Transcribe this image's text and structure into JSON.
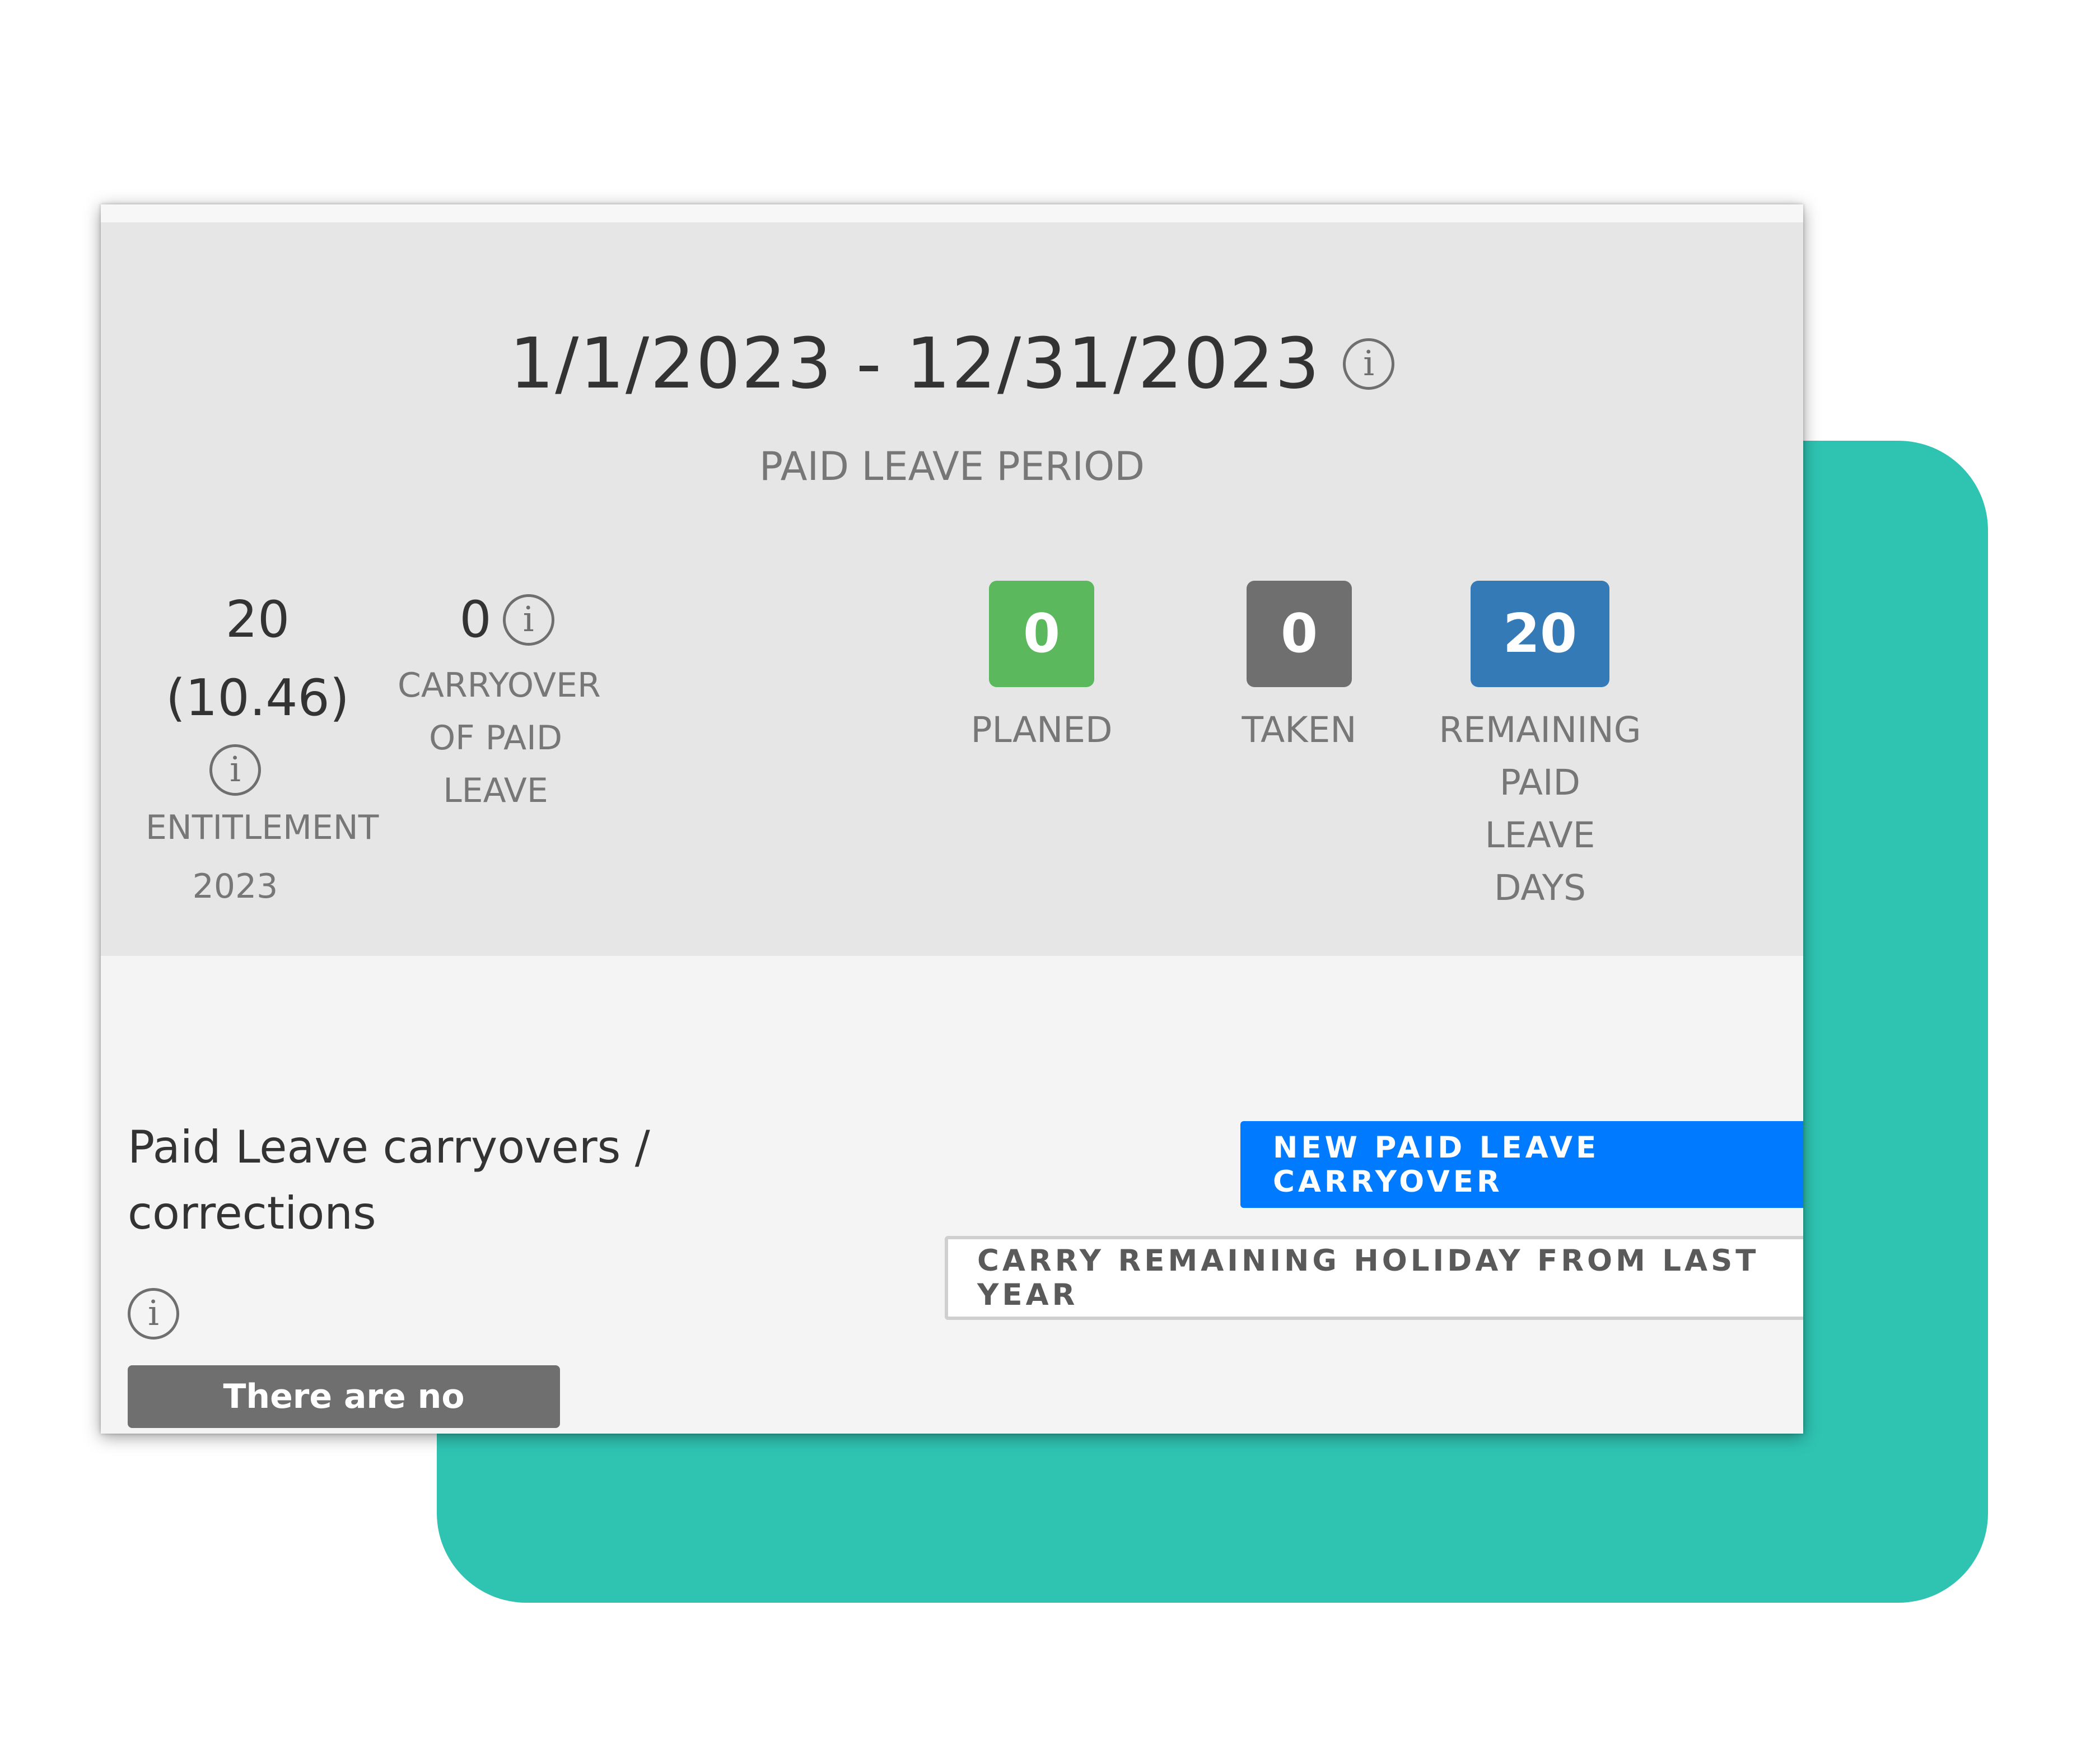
{
  "period": {
    "dates": "1/1/2023 - 12/31/2023",
    "label": "PAID LEAVE PERIOD",
    "info_icon": "info-icon"
  },
  "entitlement": {
    "value_line1": "20",
    "value_line2": "(10.46)",
    "label": "ENTITLEMENT",
    "year": "2023"
  },
  "carryover": {
    "value": "0",
    "label_line1": "CARRYOVER",
    "label_line2": "OF PAID",
    "label_line3": "LEAVE"
  },
  "badges": {
    "planned": {
      "value": "0",
      "label": "PLANED",
      "color": "#5cb85c"
    },
    "taken": {
      "value": "0",
      "label": "TAKEN",
      "color": "#6f6f6f"
    },
    "remaining": {
      "value": "20",
      "label_line1": "REMAINING",
      "label_line2": "PAID",
      "label_line3": "LEAVE",
      "label_line4": "DAYS",
      "color": "#337ab7"
    }
  },
  "section": {
    "title_line1": "Paid Leave carryovers /",
    "title_line2": "corrections",
    "empty_message": "There are no carryovers"
  },
  "buttons": {
    "new_carryover": "NEW PAID LEAVE CARRYOVER",
    "carry_remaining": "CARRY REMAINING HOLIDAY FROM LAST YEAR"
  },
  "colors": {
    "teal_background": "#2fc4b2",
    "primary_button": "#007bff"
  }
}
